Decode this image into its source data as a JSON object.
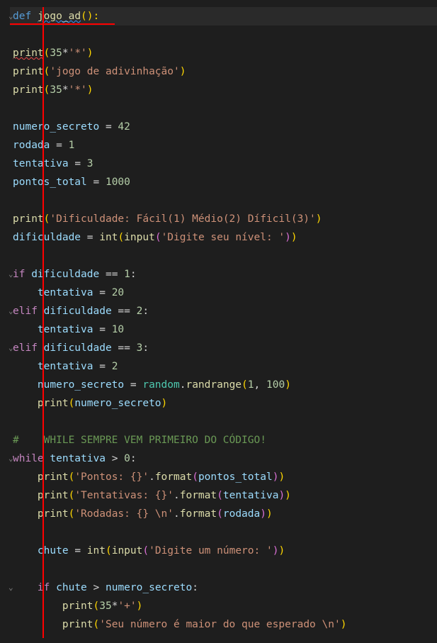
{
  "code": {
    "l1": {
      "def": "def",
      "name": "jogo_ad",
      "parens": "():"
    },
    "l3": {
      "fn": "print",
      "arg_num": "35",
      "op": "*",
      "str": "'*'"
    },
    "l4": {
      "fn": "print",
      "str": "'jogo de adivinhação'"
    },
    "l5": {
      "fn": "print",
      "arg_num": "35",
      "op": "*",
      "str": "'*'"
    },
    "l7": {
      "var": "numero_secreto",
      "op": "=",
      "val": "42"
    },
    "l8": {
      "var": "rodada",
      "op": "=",
      "val": "1"
    },
    "l9": {
      "var": "tentativa",
      "op": "=",
      "val": "3"
    },
    "l10": {
      "var": "pontos_total",
      "op": "=",
      "val": "1000"
    },
    "l12": {
      "fn": "print",
      "str": "'Dificuldade: Fácil(1) Médio(2) Díficil(3)'"
    },
    "l13": {
      "var": "dificuldade",
      "op": "=",
      "fn1": "int",
      "fn2": "input",
      "str": "'Digite seu nível: '"
    },
    "l15": {
      "kw": "if",
      "var": "dificuldade",
      "op": "==",
      "val": "1",
      "colon": ":"
    },
    "l16": {
      "var": "tentativa",
      "op": "=",
      "val": "20"
    },
    "l17": {
      "kw": "elif",
      "var": "dificuldade",
      "op": "==",
      "val": "2",
      "colon": ":"
    },
    "l18": {
      "var": "tentativa",
      "op": "=",
      "val": "10"
    },
    "l19": {
      "kw": "elif",
      "var": "dificuldade",
      "op": "==",
      "val": "3",
      "colon": ":"
    },
    "l20": {
      "var": "tentativa",
      "op": "=",
      "val": "2"
    },
    "l21": {
      "var": "numero_secreto",
      "op": "=",
      "obj": "random",
      "fn": "randrange",
      "a1": "1",
      "a2": "100"
    },
    "l22": {
      "fn": "print",
      "var": "numero_secreto"
    },
    "l24": {
      "comment": "#    WHILE SEMPRE VEM PRIMEIRO DO CÓDIGO!"
    },
    "l25": {
      "kw": "while",
      "var": "tentativa",
      "op": ">",
      "val": "0",
      "colon": ":"
    },
    "l26": {
      "fn": "print",
      "str": "'Pontos: {}'",
      "method": "format",
      "var": "pontos_total"
    },
    "l27": {
      "fn": "print",
      "str": "'Tentativas: {}'",
      "method": "format",
      "var": "tentativa"
    },
    "l28": {
      "fn": "print",
      "str": "'Rodadas: {} \\n'",
      "method": "format",
      "var": "rodada"
    },
    "l30": {
      "var": "chute",
      "op": "=",
      "fn1": "int",
      "fn2": "input",
      "str": "'Digite um número: '"
    },
    "l32": {
      "kw": "if",
      "var1": "chute",
      "op": ">",
      "var2": "numero_secreto",
      "colon": ":"
    },
    "l33": {
      "fn": "print",
      "arg_num": "35",
      "op": "*",
      "str": "'+'"
    },
    "l34": {
      "fn": "print",
      "str": "'Seu número é maior do que esperado \\n'"
    }
  }
}
